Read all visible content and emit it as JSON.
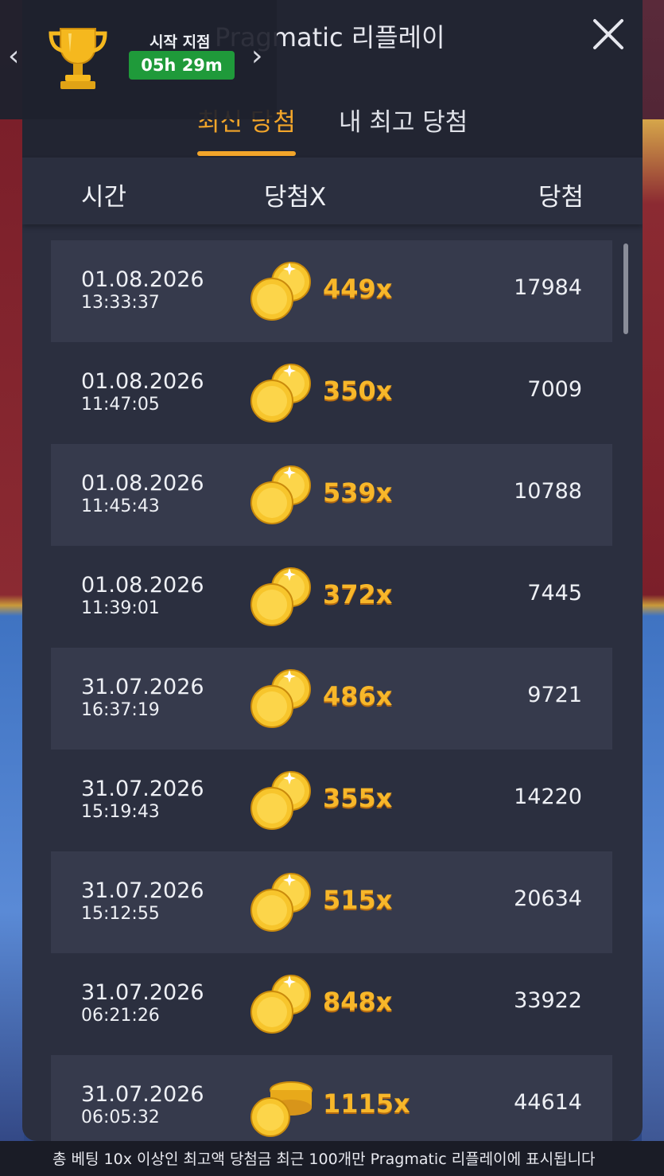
{
  "header": {
    "title": "Pragmatic 리플레이",
    "close_icon": "close-icon"
  },
  "tabs": [
    {
      "label": "최신 당첨",
      "active": true
    },
    {
      "label": "내 최고 당첨",
      "active": false
    }
  ],
  "columns": {
    "time": "시간",
    "multiplier": "당첨X",
    "win": "당첨"
  },
  "timer": {
    "label": "시작 지점",
    "value": "05h 29m"
  },
  "rows": [
    {
      "date": "01.08.2026",
      "time": "13:33:37",
      "mult": "449x",
      "win": "17984"
    },
    {
      "date": "01.08.2026",
      "time": "11:47:05",
      "mult": "350x",
      "win": "7009"
    },
    {
      "date": "01.08.2026",
      "time": "11:45:43",
      "mult": "539x",
      "win": "10788"
    },
    {
      "date": "01.08.2026",
      "time": "11:39:01",
      "mult": "372x",
      "win": "7445"
    },
    {
      "date": "31.07.2026",
      "time": "16:37:19",
      "mult": "486x",
      "win": "9721"
    },
    {
      "date": "31.07.2026",
      "time": "15:19:43",
      "mult": "355x",
      "win": "14220"
    },
    {
      "date": "31.07.2026",
      "time": "15:12:55",
      "mult": "515x",
      "win": "20634"
    },
    {
      "date": "31.07.2026",
      "time": "06:21:26",
      "mult": "848x",
      "win": "33922"
    },
    {
      "date": "31.07.2026",
      "time": "06:05:32",
      "mult": "1115x",
      "win": "44614"
    }
  ],
  "footer": {
    "note": "총 베팅 10x 이상인 최고액 당첨금 최근 100개만 Pragmatic 리플레이에 표시됩니다"
  },
  "colors": {
    "accent": "#f2a52a",
    "panel": "#2b2f3f",
    "timer_green": "#1f9a3a"
  }
}
